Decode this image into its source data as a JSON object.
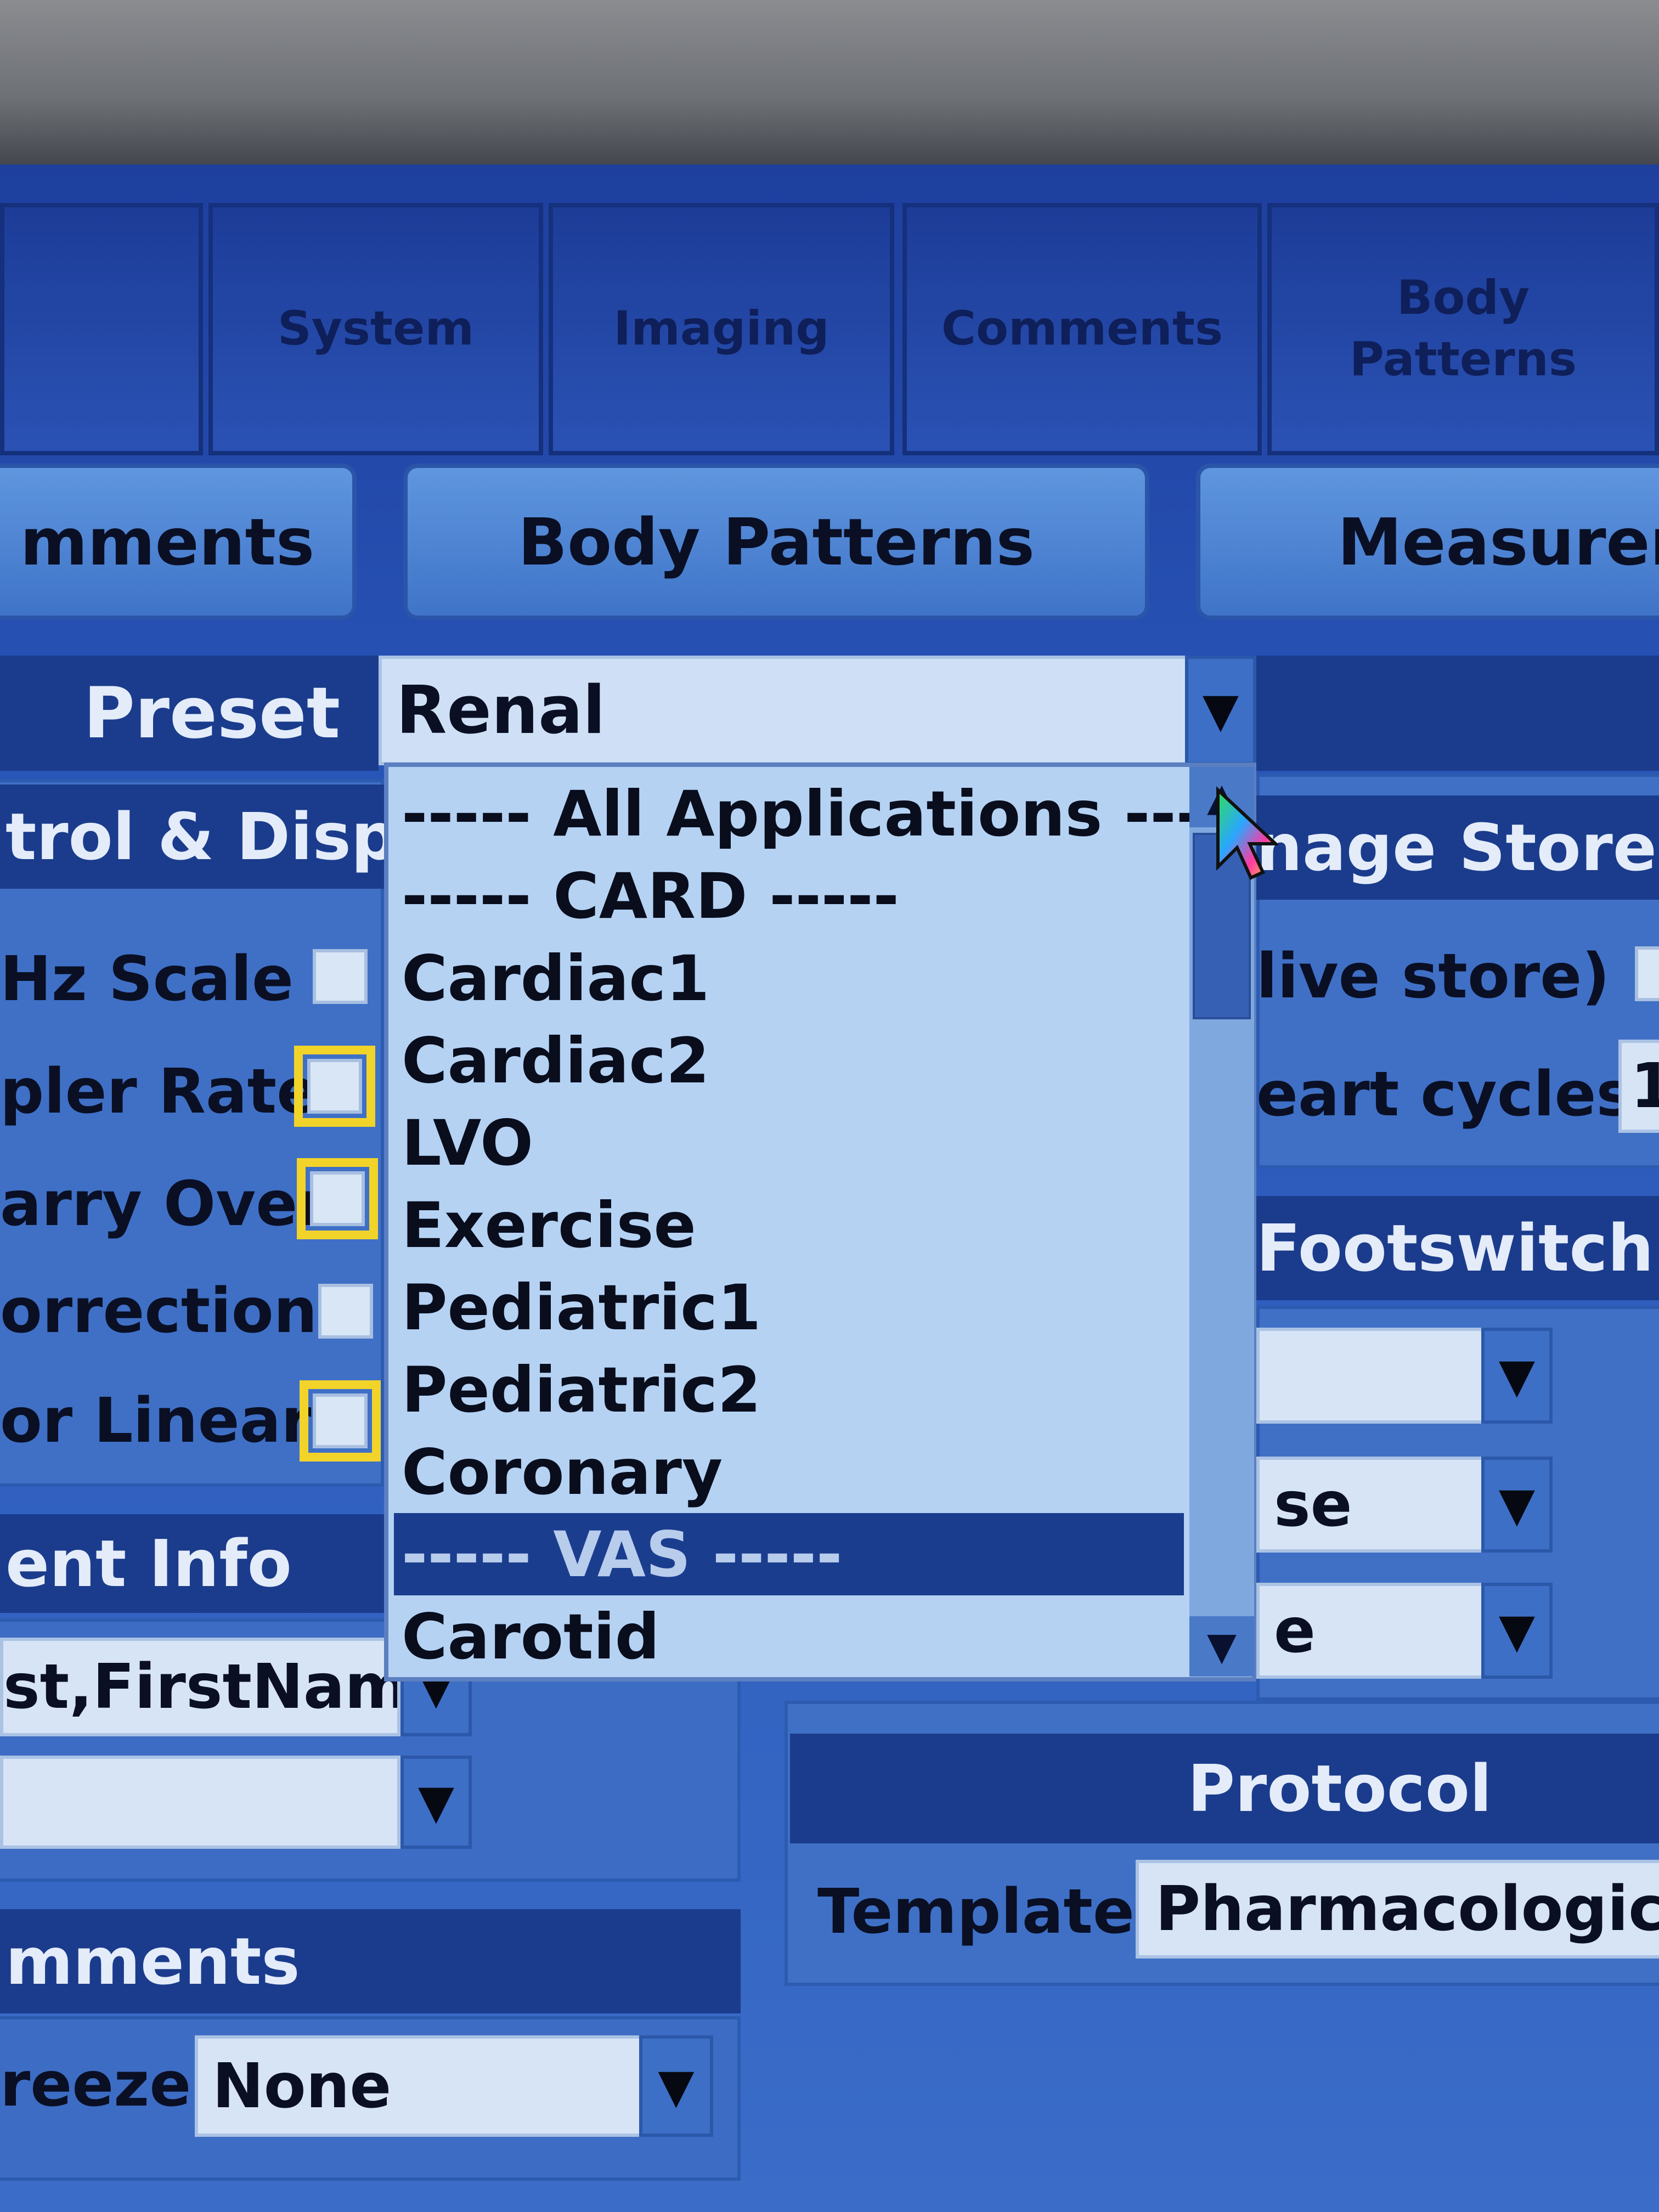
{
  "tabs": {
    "top": [
      "System",
      "Imaging",
      "Comments",
      "Body Patterns"
    ],
    "sub": [
      "mments",
      "Body Patterns",
      "Measurem"
    ]
  },
  "preset": {
    "label": "Preset",
    "value": "Renal",
    "options": [
      "----- All Applications -----",
      "----- CARD -----",
      "Cardiac1",
      "Cardiac2",
      "LVO",
      "Exercise",
      "Pediatric1",
      "Pediatric2",
      "Coronary",
      "----- VAS -----",
      "Carotid"
    ],
    "highlighted_option": "----- VAS -----"
  },
  "control_display": {
    "header": "trol & Displa",
    "rows": [
      "Hz Scale",
      "pler Rate",
      "arry Over",
      "orrection",
      "or Linear"
    ]
  },
  "patient_info": {
    "header": "ent Info",
    "name_value": "st,FirstName",
    "second_value": ""
  },
  "comments": {
    "header": "mments",
    "freeze_label": "reeze",
    "freeze_value": "None"
  },
  "image_store": {
    "header": "nage Store",
    "live_store_label": "live store)",
    "heart_cycles_label": "eart cycles",
    "heart_cycles_value": "1"
  },
  "footswitch": {
    "header": "Footswitch",
    "combo1": "",
    "combo2": "se",
    "combo3": "e"
  },
  "protocol": {
    "header": "Protocol",
    "template_label": "Template",
    "template_value": "Pharmacologica"
  },
  "icons": {
    "dropdown_arrow": "triangle-down",
    "scroll_up": "triangle-up",
    "scroll_down": "triangle-down",
    "cursor": "arrow-cursor"
  },
  "colors": {
    "screen_bg": "#2855b8",
    "header_bar": "#1b3c8c",
    "dropdown_bg": "#b5d2f3",
    "selected_row": "#1a3d8e",
    "focus_outline": "#f2d32a"
  }
}
